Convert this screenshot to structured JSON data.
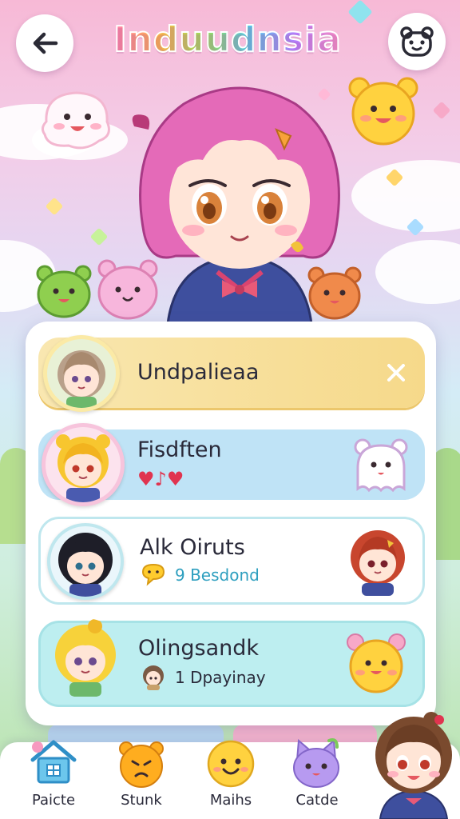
{
  "header": {
    "title": "Induudnsia",
    "back_icon": "back-arrow-icon",
    "profile_icon": "bear-face-icon"
  },
  "list": {
    "items": [
      {
        "title": "Undpalieaa",
        "action_icon": "close-icon"
      },
      {
        "title": "Fisdften",
        "subtitle": "♥♪♥"
      },
      {
        "title": "Alk Oiruts",
        "subtitle": "9 Besdond"
      },
      {
        "title": "Olingsandk",
        "subtitle": "1 Dpayinay"
      }
    ]
  },
  "nav": {
    "items": [
      {
        "label": "Paicte",
        "icon": "house-icon"
      },
      {
        "label": "Stunk",
        "icon": "angry-bear-icon"
      },
      {
        "label": "Maihs",
        "icon": "smile-face-icon"
      },
      {
        "label": "Catde",
        "icon": "purple-cat-icon"
      }
    ]
  },
  "colors": {
    "accent_pink": "#f07ab0",
    "row_yellow": "#f6d98a",
    "row_blue": "#bfe3f6",
    "row_teal": "#bdeef0",
    "text_blue": "#2e9fbf"
  }
}
